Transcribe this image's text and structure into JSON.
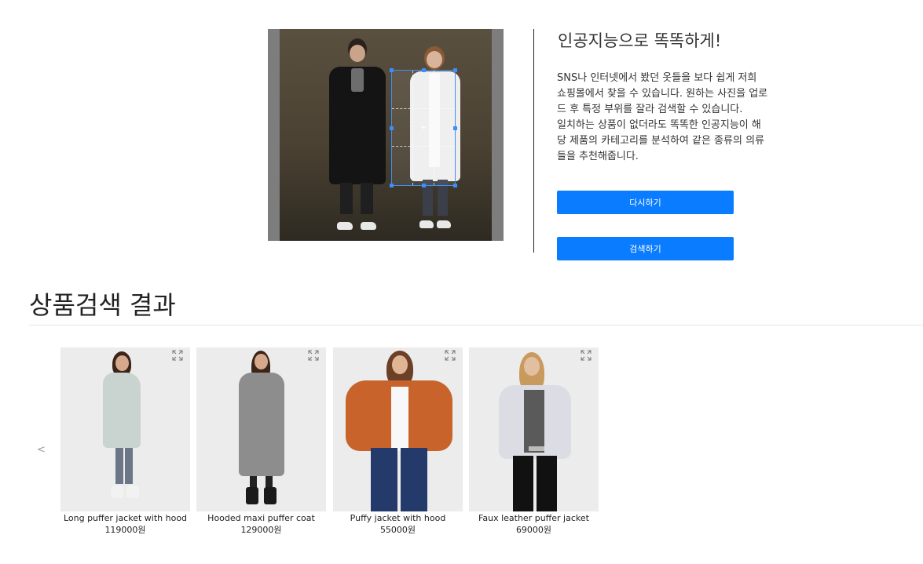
{
  "intro": {
    "title": "인공지능으로 똑똑하게!",
    "paragraph1": "SNS나 인터넷에서 봤던 옷들을 보다 쉽게 저희 쇼핑몰에서 찾을 수 있습니다. 원하는 사진을 업로드 후 특정 부위를 잘라 검색할 수 있습니다.",
    "paragraph2": "일치하는 상품이 없더라도 똑똑한 인공지능이 해당 제품의 카테고리를 분석하여 같은 종류의 의류들을 추천해줍니다.",
    "retry_label": "다시하기",
    "search_label": "검색하기"
  },
  "results": {
    "title": "상품검색 결과",
    "prev_label": "<",
    "items": [
      {
        "name": "Long puffer jacket with hood",
        "price": "119000원",
        "color": "#c9d3cf"
      },
      {
        "name": "Hooded maxi puffer coat",
        "price": "129000원",
        "color": "#8d8d8d"
      },
      {
        "name": "Puffy jacket with hood",
        "price": "55000원",
        "color": "#c8632b"
      },
      {
        "name": "Faux leather puffer jacket",
        "price": "69000원",
        "color": "#dcdde4"
      }
    ]
  },
  "colors": {
    "button": "#0a7cff",
    "crop_border": "#3e8ef7"
  }
}
